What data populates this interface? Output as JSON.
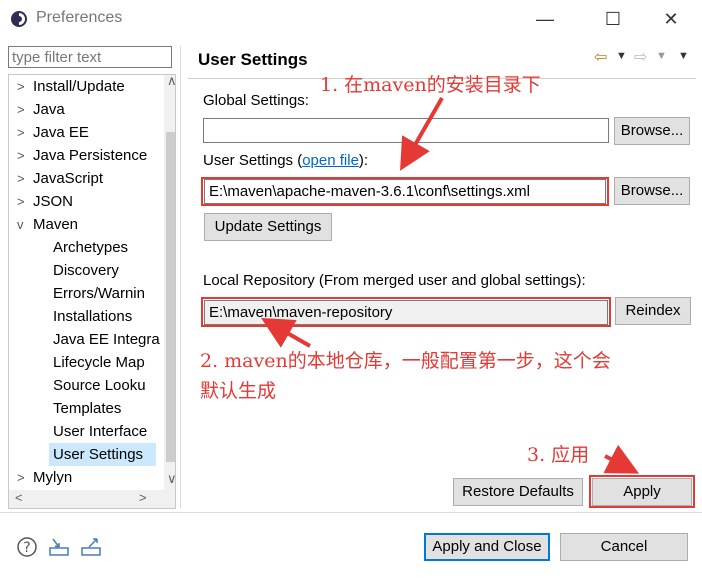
{
  "window": {
    "title": "Preferences"
  },
  "filter": {
    "placeholder": "type filter text"
  },
  "tree": {
    "items": [
      {
        "label": "Install/Update",
        "expander": ">"
      },
      {
        "label": "Java",
        "expander": ">"
      },
      {
        "label": "Java EE",
        "expander": ">"
      },
      {
        "label": "Java Persistence",
        "expander": ">"
      },
      {
        "label": "JavaScript",
        "expander": ">"
      },
      {
        "label": "JSON",
        "expander": ">"
      },
      {
        "label": "Maven",
        "expander": "v"
      },
      {
        "label": "Archetypes"
      },
      {
        "label": "Discovery"
      },
      {
        "label": "Errors/Warnin"
      },
      {
        "label": "Installations"
      },
      {
        "label": "Java EE Integra"
      },
      {
        "label": "Lifecycle Map"
      },
      {
        "label": "Source Looku"
      },
      {
        "label": "Templates"
      },
      {
        "label": "User Interface"
      },
      {
        "label": "User Settings"
      },
      {
        "label": "Mylyn",
        "expander": ">"
      }
    ],
    "selected": "User Settings"
  },
  "page": {
    "title": "User Settings",
    "global_settings_label": "Global Settings:",
    "global_settings_value": "",
    "browse_label": "Browse...",
    "user_settings_label": "User Settings (",
    "open_file_link": "open file",
    "user_settings_label_end": "):",
    "user_settings_value": "E:\\maven\\apache-maven-3.6.1\\conf\\settings.xml",
    "update_settings_label": "Update Settings",
    "local_repo_label": "Local Repository (From merged user and global settings):",
    "local_repo_value": "E:\\maven\\maven-repository",
    "reindex_label": "Reindex",
    "restore_defaults_label": "Restore Defaults",
    "apply_label": "Apply"
  },
  "annotations": {
    "a1": "1. 在maven的安装目录下",
    "a2_line1": "2. maven的本地仓库，一般配置第一步，这个会",
    "a2_line2": "默认生成",
    "a3": "3. 应用"
  },
  "footer": {
    "apply_close_label": "Apply and Close",
    "cancel_label": "Cancel"
  },
  "colors": {
    "annotation": "#e53935",
    "link": "#0066cc",
    "selected": "#cce8ff"
  },
  "icons": [
    "preferences-app-icon",
    "help-icon",
    "import-icon",
    "export-icon",
    "back-arrow-icon",
    "forward-arrow-icon"
  ]
}
